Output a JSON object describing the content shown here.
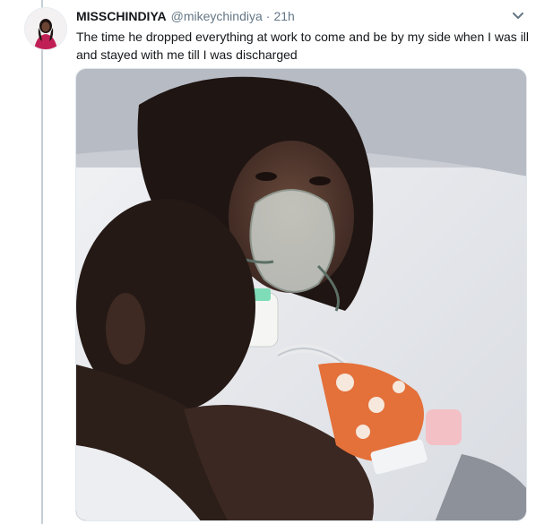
{
  "tweet": {
    "display_name": "MISSCHINDIYA",
    "handle": "@mikeychindiya",
    "separator": "·",
    "timestamp": "21h",
    "text": "The time he dropped everything at work to come and be by my side when I was ill and stayed with me till I was discharged",
    "menu_icon": "chevron-down-icon",
    "avatar_icon": "profile-avatar",
    "media": "photo"
  },
  "colors": {
    "text_primary": "#14171a",
    "text_secondary": "#657786",
    "thread_line": "#c4cfd6"
  }
}
